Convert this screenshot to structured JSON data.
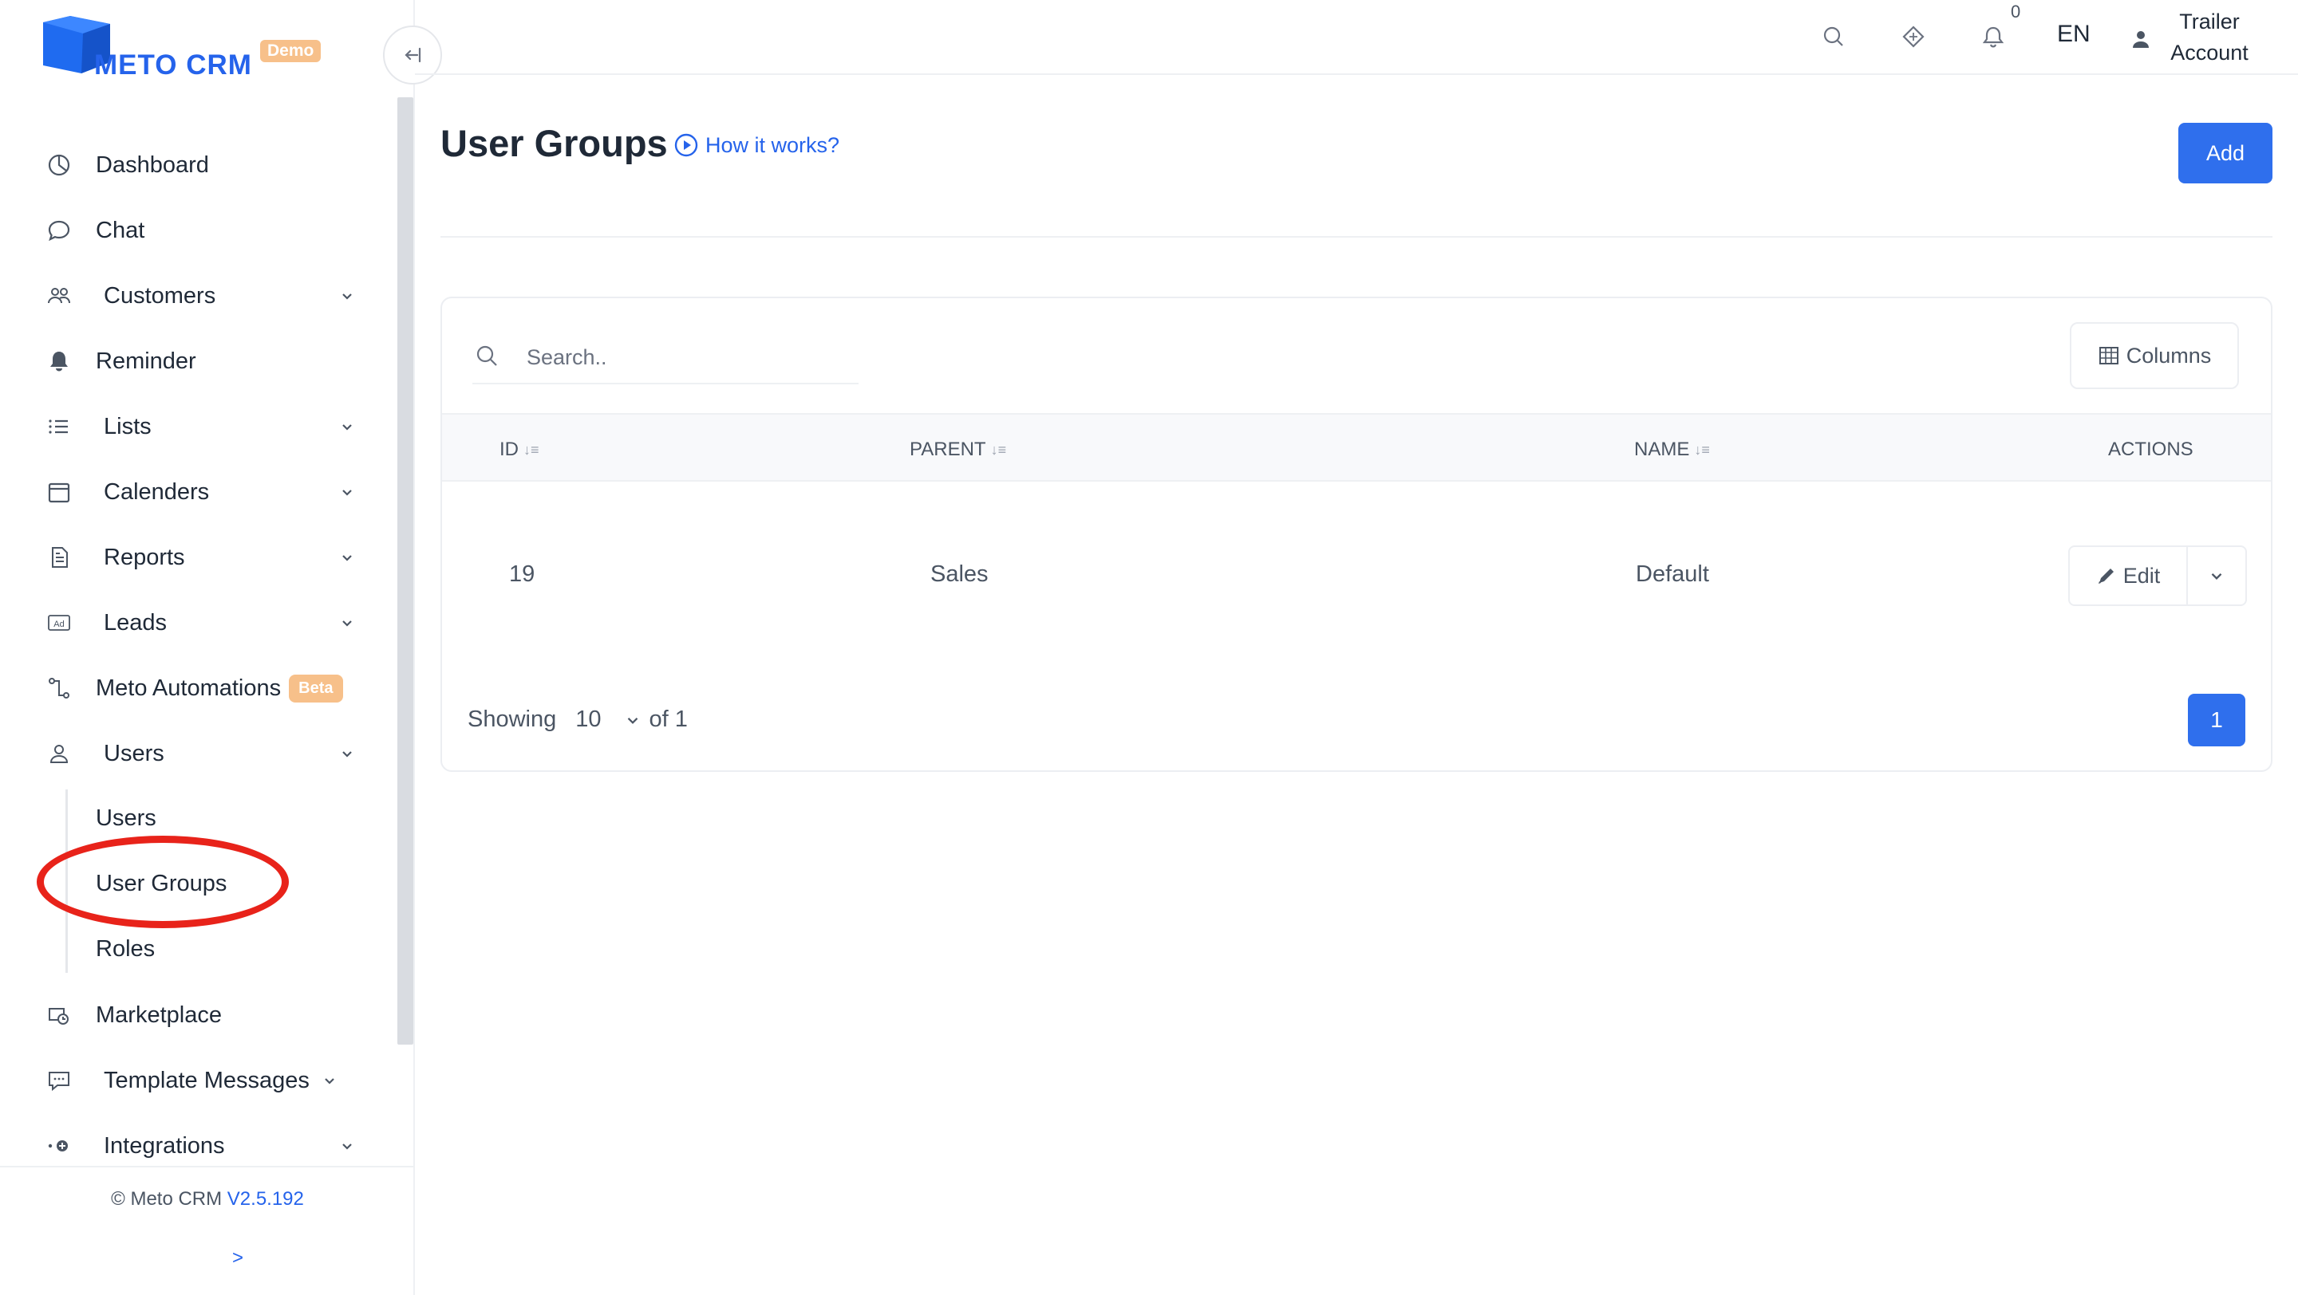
{
  "brand": {
    "name": "METO CRM",
    "badge": "Demo",
    "colors": {
      "primary": "#2563eb",
      "badge": "#f7c08a",
      "highlight": "#e8231a"
    }
  },
  "sidebar": {
    "items": [
      {
        "label": "Dashboard",
        "icon": "dashboard-icon",
        "has_dropdown": false
      },
      {
        "label": "Chat",
        "icon": "chat-bubble-icon",
        "has_dropdown": false
      },
      {
        "label": "Customers",
        "icon": "customers-icon",
        "has_dropdown": true
      },
      {
        "label": "Reminder",
        "icon": "bell-icon",
        "has_dropdown": false
      },
      {
        "label": "Lists",
        "icon": "list-icon",
        "has_dropdown": true
      },
      {
        "label": "Calenders",
        "icon": "calendar-icon",
        "has_dropdown": true
      },
      {
        "label": "Reports",
        "icon": "report-icon",
        "has_dropdown": true
      },
      {
        "label": "Leads",
        "icon": "ad-icon",
        "has_dropdown": true
      },
      {
        "label": "Meto Automations",
        "icon": "automation-icon",
        "has_dropdown": false,
        "badge": "Beta"
      },
      {
        "label": "Users",
        "icon": "user-icon",
        "has_dropdown": true
      },
      {
        "label": "Marketplace",
        "icon": "marketplace-icon",
        "has_dropdown": false
      },
      {
        "label": "Template Messages",
        "icon": "message-template-icon",
        "has_dropdown": true
      },
      {
        "label": "Integrations",
        "icon": "integrations-icon",
        "has_dropdown": true
      }
    ],
    "users_submenu": [
      "Users",
      "User Groups",
      "Roles"
    ],
    "active_subitem": "User Groups",
    "footer": {
      "copyright": "© Meto CRM",
      "version": "V2.5.192",
      "expand": ">"
    }
  },
  "header": {
    "notification_count": "0",
    "language": "EN",
    "account_line1": "Trailer",
    "account_line2": "Account"
  },
  "page": {
    "title": "User Groups",
    "help_link": "How it works?",
    "add_label": "Add"
  },
  "table": {
    "search_placeholder": "Search..",
    "columns_label": "Columns",
    "headers": {
      "id": "ID",
      "parent": "PARENT",
      "name": "NAME",
      "actions": "ACTIONS"
    },
    "rows": [
      {
        "id": "19",
        "parent": "Sales",
        "name": "Default",
        "edit_label": "Edit"
      }
    ],
    "pagination": {
      "showing_label": "Showing",
      "page_size": "10",
      "of_label": "of 1",
      "current_page": "1"
    }
  }
}
